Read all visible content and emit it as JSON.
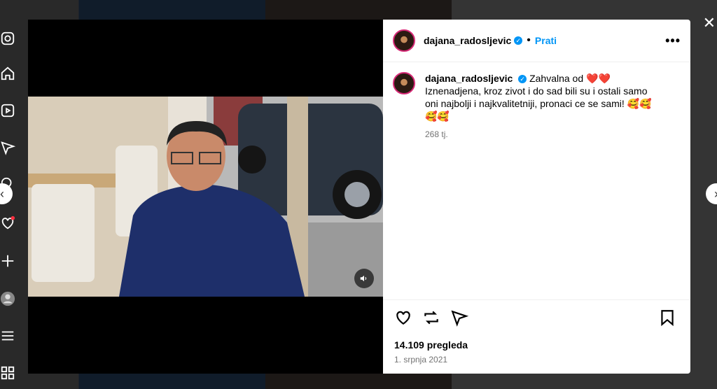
{
  "post": {
    "username": "dajana_radosljevic",
    "follow_label": "Prati",
    "more_label": "•••",
    "caption": "Zahvalna od ❤️❤️ Iznenadjena, kroz zivot i do sad bili su i ostali samo oni najbolji i najkvalitetniji, pronaci ce se sami! 🥰🥰🥰🥰",
    "caption_age": "268 tj.",
    "views": "14.109 pregleda",
    "date": "1. srpnja 2021"
  },
  "controls": {
    "close": "✕",
    "prev": "‹",
    "next": "›"
  },
  "icons": {
    "sidebar": [
      "instagram-icon",
      "home-icon",
      "reels-icon",
      "send-icon",
      "search-icon",
      "heart-icon",
      "create-icon",
      "profile-icon",
      "menu-icon",
      "apps-icon"
    ],
    "actions": [
      "like-icon",
      "repost-icon",
      "share-icon",
      "save-icon"
    ]
  }
}
